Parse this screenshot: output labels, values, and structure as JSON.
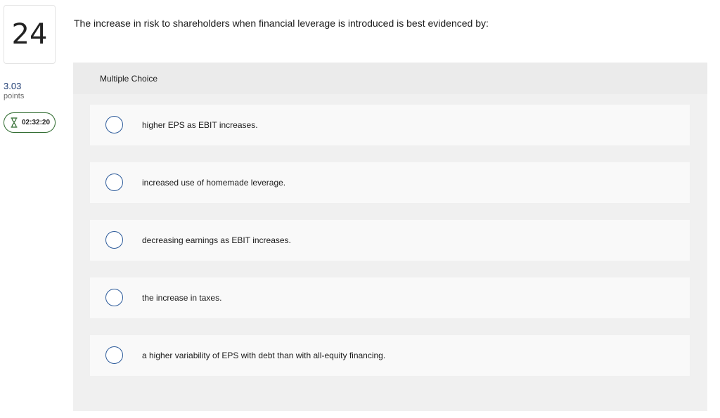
{
  "question_number": "24",
  "points": {
    "value": "3.03",
    "label": "points"
  },
  "timer": {
    "icon": "hourglass-icon",
    "time": "02:32:20",
    "color": "#2f6b2f"
  },
  "question_text": "The increase in risk to shareholders when financial leverage is introduced is best evidenced by:",
  "answer_panel": {
    "title": "Multiple Choice",
    "choices": [
      {
        "label": "higher EPS as EBIT increases."
      },
      {
        "label": "increased use of homemade leverage."
      },
      {
        "label": "decreasing earnings as EBIT increases."
      },
      {
        "label": "the increase in taxes."
      },
      {
        "label": "a higher variability of EPS with debt than with all-equity financing."
      }
    ]
  },
  "colors": {
    "accent": "#2b5a9a",
    "points": "#1f3d73",
    "panel_bg": "#f0f0f0",
    "choice_bg": "#f9f9f9"
  }
}
